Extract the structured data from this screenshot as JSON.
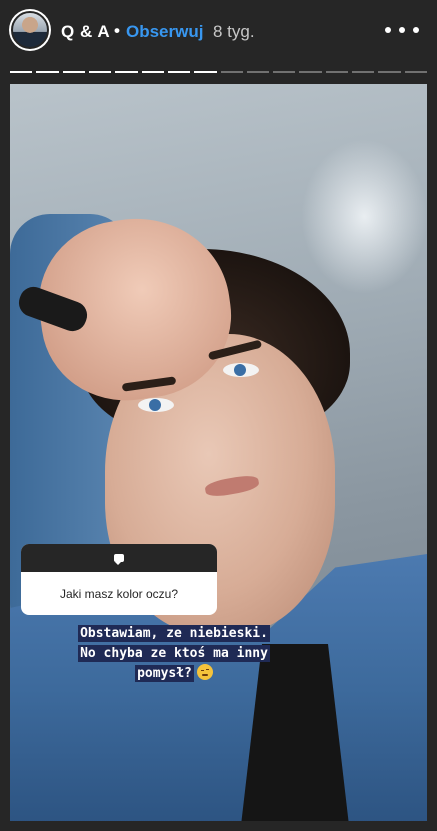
{
  "header": {
    "account_name": "Q & A",
    "separator": "•",
    "follow_label": "Obserwuj",
    "time_ago": "8 tyg.",
    "more_icon": "more-horizontal-icon"
  },
  "progress": {
    "segments_total": 16,
    "segments_done": 8
  },
  "story": {
    "question_sticker": {
      "icon": "speech-bubble-icon",
      "question": "Jaki masz kolor oczu?"
    },
    "answer_lines": [
      "Obstawiam, ze niebieski.",
      "No chyba ze ktoś ma inny",
      "pomysł?"
    ],
    "answer_emoji": "smirk-emoji-icon"
  },
  "colors": {
    "background": "#262626",
    "follow": "#3897f0",
    "answer_highlight": "#1f2a55"
  }
}
